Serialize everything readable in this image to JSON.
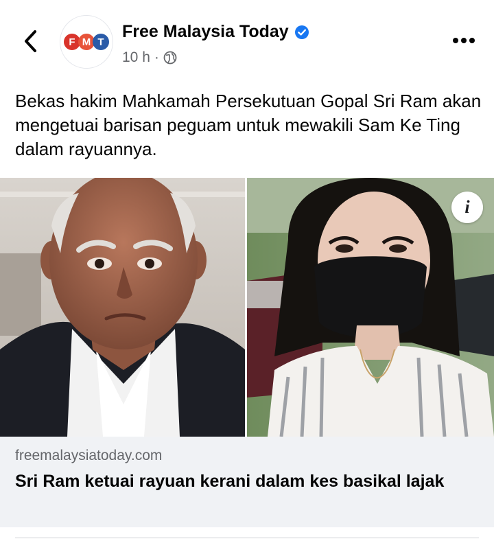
{
  "header": {
    "back_icon": "chevron-left-icon",
    "page_name": "Free Malaysia Today",
    "verified_icon": "verified-badge-icon",
    "time_ago": "10 h",
    "meta_separator": "·",
    "audience_icon": "globe-icon",
    "more_icon": "ellipsis-icon",
    "avatar": {
      "letters": [
        "F",
        "M",
        "T"
      ],
      "colors": [
        "#d9342b",
        "#e8543a",
        "#2a5ba8"
      ]
    }
  },
  "post": {
    "caption": "Bekas hakim Mahkamah Persekutuan Gopal Sri Ram akan mengetuai barisan peguam untuk mewakili Sam Ke Ting dalam rayuannya.",
    "info_icon": "info-icon",
    "info_glyph": "i"
  },
  "link_card": {
    "domain": "freemalaysiatoday.com",
    "headline": "Sri Ram ketuai rayuan kerani dalam kes basikal lajak"
  },
  "colors": {
    "verified_blue": "#1877f2",
    "secondary_text": "#65676b",
    "card_bg": "#f0f2f5"
  }
}
